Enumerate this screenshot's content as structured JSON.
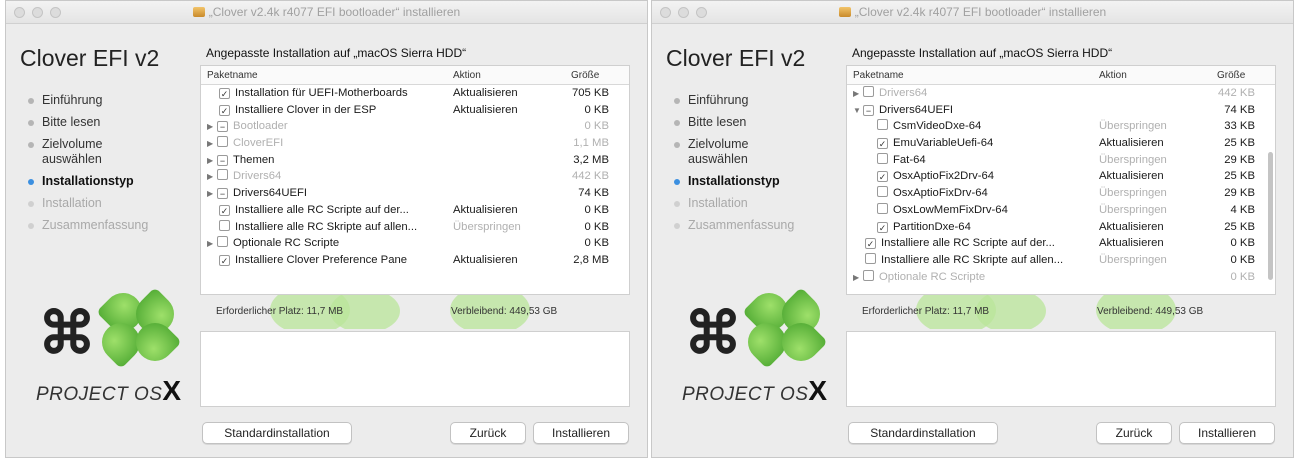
{
  "windows": [
    {
      "title": "„Clover v2.4k r4077 EFI bootloader“ installieren",
      "brand": "Clover EFI v2",
      "steps": [
        {
          "label": "Einführung",
          "state": "done"
        },
        {
          "label": "Bitte lesen",
          "state": "done"
        },
        {
          "label": "Zielvolume auswählen",
          "state": "done"
        },
        {
          "label": "Installationstyp",
          "state": "active"
        },
        {
          "label": "Installation",
          "state": "pending"
        },
        {
          "label": "Zusammenfassung",
          "state": "pending"
        }
      ],
      "logo_text": "PROJECT OS",
      "logo_x": "X",
      "heading": "Angepasste Installation auf „macOS Sierra HDD“",
      "columns": {
        "name": "Paketname",
        "action": "Aktion",
        "size": "Größe"
      },
      "rows": [
        {
          "indent": 1,
          "tri": "",
          "cb": "✓",
          "name": "Installation für UEFI-Motherboards",
          "action": "Aktualisieren",
          "size": "705 KB",
          "dim": false
        },
        {
          "indent": 1,
          "tri": "",
          "cb": "✓",
          "name": "Installiere Clover in der ESP",
          "action": "Aktualisieren",
          "size": "0 KB",
          "dim": false
        },
        {
          "indent": 0,
          "tri": "▶",
          "cb": "−",
          "name": "Bootloader",
          "action": "",
          "size": "0 KB",
          "dim": true
        },
        {
          "indent": 0,
          "tri": "▶",
          "cb": "",
          "name": "CloverEFI",
          "action": "",
          "size": "1,1 MB",
          "dim": true
        },
        {
          "indent": 0,
          "tri": "▶",
          "cb": "−",
          "name": "Themen",
          "action": "",
          "size": "3,2 MB",
          "dim": false
        },
        {
          "indent": 0,
          "tri": "▶",
          "cb": "",
          "name": "Drivers64",
          "action": "",
          "size": "442 KB",
          "dim": true
        },
        {
          "indent": 0,
          "tri": "▶",
          "cb": "−",
          "name": "Drivers64UEFI",
          "action": "",
          "size": "74 KB",
          "dim": false
        },
        {
          "indent": 1,
          "tri": "",
          "cb": "✓",
          "name": "Installiere alle RC Scripte auf der...",
          "action": "Aktualisieren",
          "size": "0 KB",
          "dim": false
        },
        {
          "indent": 1,
          "tri": "",
          "cb": "",
          "name": "Installiere alle RC Skripte auf allen...",
          "action": "Überspringen",
          "size": "0 KB",
          "dim": false,
          "skip": true
        },
        {
          "indent": 0,
          "tri": "▶",
          "cb": "",
          "name": "Optionale RC Scripte",
          "action": "",
          "size": "0 KB",
          "dim": false
        },
        {
          "indent": 1,
          "tri": "",
          "cb": "✓",
          "name": "Installiere Clover Preference Pane",
          "action": "Aktualisieren",
          "size": "2,8 MB",
          "dim": false
        }
      ],
      "space_label": "Erforderlicher Platz:",
      "space_value": "11,7 MB",
      "remaining_label": "Verbleibend:",
      "remaining_value": "449,53 GB",
      "buttons": {
        "standard": "Standardinstallation",
        "back": "Zurück",
        "install": "Installieren"
      }
    },
    {
      "title": "„Clover v2.4k r4077 EFI bootloader“ installieren",
      "brand": "Clover EFI v2",
      "steps": [
        {
          "label": "Einführung",
          "state": "done"
        },
        {
          "label": "Bitte lesen",
          "state": "done"
        },
        {
          "label": "Zielvolume auswählen",
          "state": "done"
        },
        {
          "label": "Installationstyp",
          "state": "active"
        },
        {
          "label": "Installation",
          "state": "pending"
        },
        {
          "label": "Zusammenfassung",
          "state": "pending"
        }
      ],
      "logo_text": "PROJECT OS",
      "logo_x": "X",
      "heading": "Angepasste Installation auf „macOS Sierra HDD“",
      "columns": {
        "name": "Paketname",
        "action": "Aktion",
        "size": "Größe"
      },
      "rows": [
        {
          "indent": 0,
          "tri": "▶",
          "cb": "",
          "name": "Drivers64",
          "action": "",
          "size": "442 KB",
          "dim": true
        },
        {
          "indent": 0,
          "tri": "▼",
          "cb": "−",
          "name": "Drivers64UEFI",
          "action": "",
          "size": "74 KB",
          "dim": false
        },
        {
          "indent": 2,
          "tri": "",
          "cb": "",
          "name": "CsmVideoDxe-64",
          "action": "Überspringen",
          "size": "33 KB",
          "dim": false,
          "skip": true
        },
        {
          "indent": 2,
          "tri": "",
          "cb": "✓",
          "name": "EmuVariableUefi-64",
          "action": "Aktualisieren",
          "size": "25 KB",
          "dim": false
        },
        {
          "indent": 2,
          "tri": "",
          "cb": "",
          "name": "Fat-64",
          "action": "Überspringen",
          "size": "29 KB",
          "dim": false,
          "skip": true
        },
        {
          "indent": 2,
          "tri": "",
          "cb": "✓",
          "name": "OsxAptioFix2Drv-64",
          "action": "Aktualisieren",
          "size": "25 KB",
          "dim": false
        },
        {
          "indent": 2,
          "tri": "",
          "cb": "",
          "name": "OsxAptioFixDrv-64",
          "action": "Überspringen",
          "size": "29 KB",
          "dim": false,
          "skip": true
        },
        {
          "indent": 2,
          "tri": "",
          "cb": "",
          "name": "OsxLowMemFixDrv-64",
          "action": "Überspringen",
          "size": "4 KB",
          "dim": false,
          "skip": true
        },
        {
          "indent": 2,
          "tri": "",
          "cb": "✓",
          "name": "PartitionDxe-64",
          "action": "Aktualisieren",
          "size": "25 KB",
          "dim": false
        },
        {
          "indent": 1,
          "tri": "",
          "cb": "✓",
          "name": "Installiere alle RC Scripte auf der...",
          "action": "Aktualisieren",
          "size": "0 KB",
          "dim": false
        },
        {
          "indent": 1,
          "tri": "",
          "cb": "",
          "name": "Installiere alle RC Skripte auf allen...",
          "action": "Überspringen",
          "size": "0 KB",
          "dim": false,
          "skip": true
        },
        {
          "indent": 0,
          "tri": "▶",
          "cb": "",
          "name": "Optionale RC Scripte",
          "action": "",
          "size": "0 KB",
          "dim": true
        }
      ],
      "space_label": "Erforderlicher Platz:",
      "space_value": "11,7 MB",
      "remaining_label": "Verbleibend:",
      "remaining_value": "449,53 GB",
      "buttons": {
        "standard": "Standardinstallation",
        "back": "Zurück",
        "install": "Installieren"
      }
    }
  ]
}
